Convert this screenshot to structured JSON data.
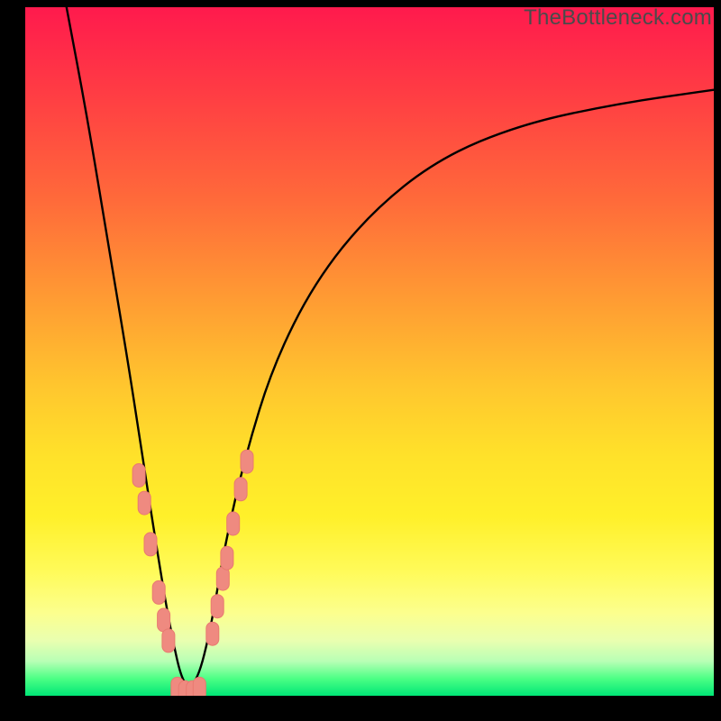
{
  "watermark": "TheBottleneck.com",
  "colors": {
    "frame": "#000000",
    "curve": "#000000",
    "marker_fill": "#ef8a80",
    "marker_stroke": "#e87a70",
    "gradient_stops": [
      "#ff1a4d",
      "#ff3b44",
      "#ff6a3a",
      "#ff9a33",
      "#ffc62e",
      "#ffe12a",
      "#fff02a",
      "#fffb5a",
      "#fcff8e",
      "#e9ffb0",
      "#b8ffb5",
      "#4cff85",
      "#00e676"
    ]
  },
  "chart_data": {
    "type": "line",
    "title": "",
    "xlabel": "",
    "ylabel": "",
    "xlim": [
      0,
      100
    ],
    "ylim": [
      0,
      100
    ],
    "note": "V-shaped bottleneck curve; minimum touches y≈0 near x≈23. Values estimated from pixel positions (no axis ticks are shown).",
    "series": [
      {
        "name": "bottleneck-curve",
        "x": [
          6,
          9,
          12,
          15,
          17,
          19,
          21,
          23,
          25,
          27,
          29,
          32,
          36,
          42,
          50,
          60,
          72,
          86,
          100
        ],
        "y": [
          100,
          84,
          66,
          48,
          35,
          22,
          10,
          1,
          2,
          10,
          22,
          35,
          48,
          60,
          70,
          78,
          83,
          86,
          88
        ]
      }
    ],
    "markers": {
      "name": "highlighted-points",
      "note": "Pink rounded markers clustered near the valley on both branches and along the floor.",
      "points": [
        {
          "x": 16.5,
          "y": 32
        },
        {
          "x": 17.3,
          "y": 28
        },
        {
          "x": 18.2,
          "y": 22
        },
        {
          "x": 19.4,
          "y": 15
        },
        {
          "x": 20.1,
          "y": 11
        },
        {
          "x": 20.8,
          "y": 8
        },
        {
          "x": 22.1,
          "y": 1
        },
        {
          "x": 23.2,
          "y": 0.5
        },
        {
          "x": 24.3,
          "y": 0.5
        },
        {
          "x": 25.3,
          "y": 1
        },
        {
          "x": 27.2,
          "y": 9
        },
        {
          "x": 27.9,
          "y": 13
        },
        {
          "x": 28.7,
          "y": 17
        },
        {
          "x": 29.3,
          "y": 20
        },
        {
          "x": 30.2,
          "y": 25
        },
        {
          "x": 31.3,
          "y": 30
        },
        {
          "x": 32.2,
          "y": 34
        }
      ]
    }
  }
}
